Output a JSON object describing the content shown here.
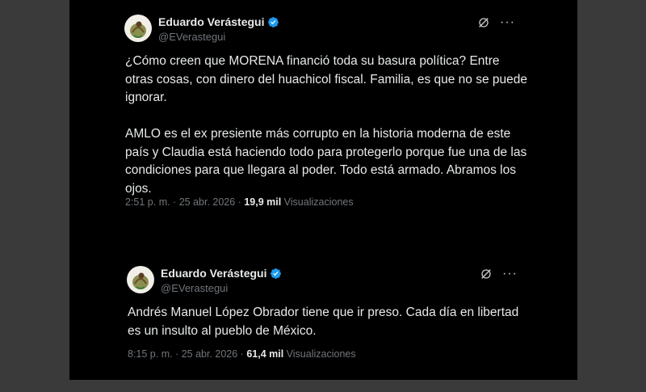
{
  "accent_color": "#1d9bf0",
  "tweets": [
    {
      "author_name": "Eduardo Verástegui",
      "handle": "@EVerastegui",
      "body": "¿Cómo creen que MORENA financió toda su basura política? Entre otras cosas, con dinero del huachicol fiscal. Familia, es que no se puede ignorar.\n\nAMLO es el ex presiente más corrupto en la historia moderna de este país y Claudia está haciendo todo para protegerlo porque fue una de las condiciones para que llegara al poder. Todo está armado. Abramos los ojos.",
      "time": "2:51 p. m. · 25 abr. 2026 · ",
      "views_count": "19,9 mil",
      "views_label": " Visualizaciones"
    },
    {
      "author_name": "Eduardo Verástegui",
      "handle": "@EVerastegui",
      "body": "Andrés Manuel López Obrador tiene que ir preso. Cada día en libertad es un insulto al pueblo de México.",
      "time": "8:15 p. m. · 25 abr. 2026 · ",
      "views_count": "61,4 mil",
      "views_label": " Visualizaciones"
    }
  ],
  "icons": {
    "grok": "grok-icon",
    "more": "more-options-icon",
    "verified": "verified-badge-icon",
    "avatar": "mexico-coat-of-arms-avatar"
  }
}
